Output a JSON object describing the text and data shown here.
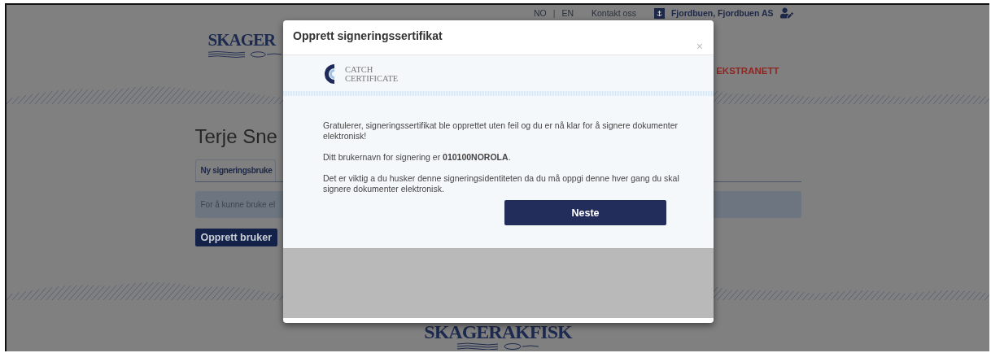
{
  "header": {
    "languages": [
      "NO",
      "EN"
    ],
    "separator": "|",
    "contact_link": "Kontakt oss",
    "account": "Fjordbuen, Fjordbuen AS"
  },
  "logo": "SKAGER",
  "nav": {
    "item": "EKSTRANETT"
  },
  "page": {
    "title": "Terje Sne",
    "tabs": [
      {
        "label": "Ny signeringsbruke",
        "selected": true
      }
    ],
    "alert": "For å kunne bruke el",
    "button": "Opprett bruker"
  },
  "footer_logo": "SKAGERAKFISK",
  "modal": {
    "title": "Opprett signeringssertifikat",
    "close": "×",
    "brand": [
      "CATCH",
      "CERTIFICATE"
    ],
    "paragraphs": [
      "Gratulerer, signeringssertifikat ble opprettet uten feil og du er nå klar for å signere dokumenter elektronisk!",
      "Ditt brukernavn for signering er **010100NOROLA**.",
      "Det er viktig a du husker denne signeringsidentiteten da du må oppgi denne hver gang du skal signere dokumenter elektronisk."
    ],
    "button": "Neste"
  }
}
